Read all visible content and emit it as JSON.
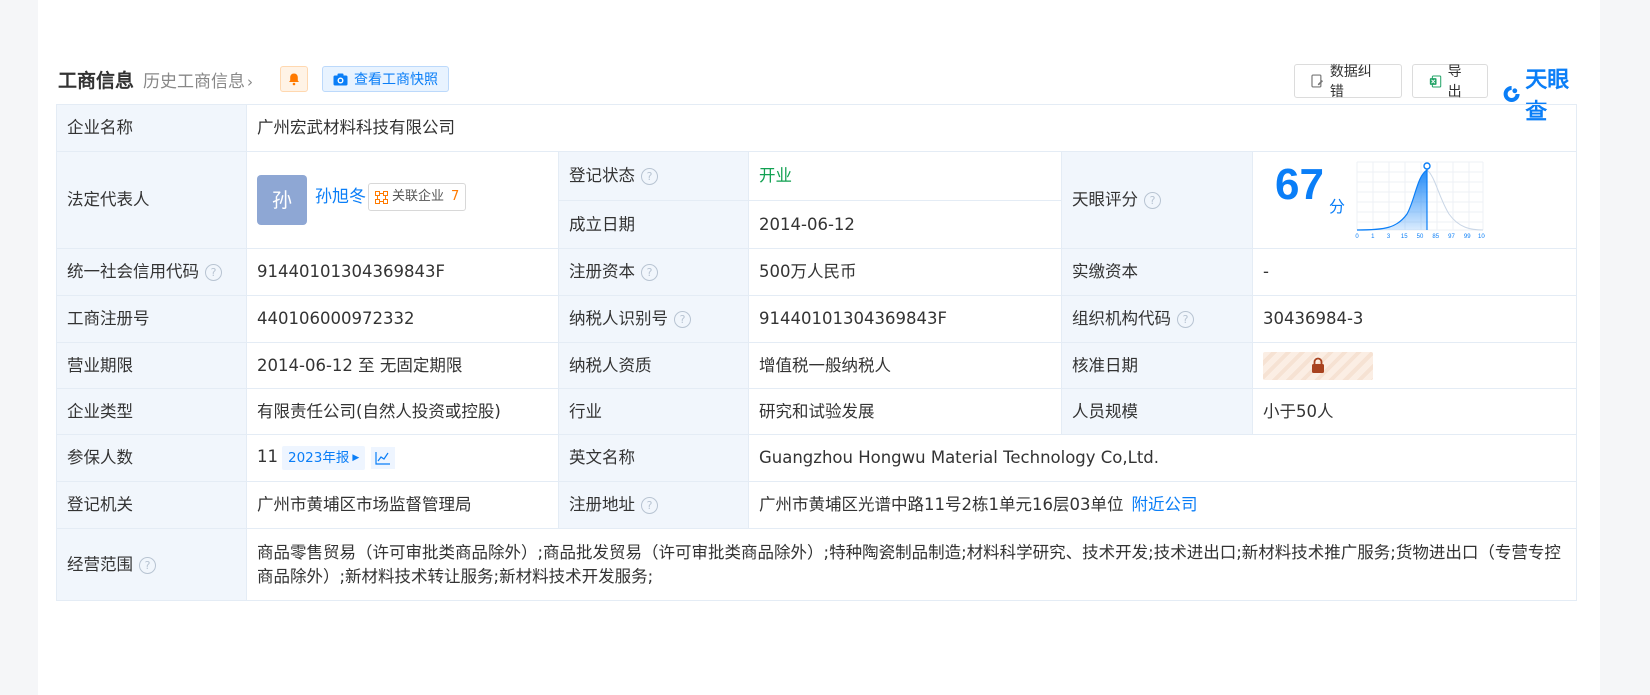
{
  "header": {
    "title": "工商信息",
    "history": "历史工商信息",
    "snapshot": "查看工商快照",
    "correct": "数据纠错",
    "export": "导出",
    "logo": "天眼查"
  },
  "colors": {
    "accent": "#0a7ef7",
    "label_bg": "#f1f6fc",
    "status_green": "#12a152",
    "rel_count": "#ff7a00"
  },
  "company": {
    "name_label": "企业名称",
    "name": "广州宏武材料科技有限公司",
    "legal_label": "法定代表人",
    "legal_avatar": "孙",
    "legal_name": "孙旭冬",
    "related_label": "关联企业",
    "related_count": "7",
    "status_label": "登记状态",
    "status": "开业",
    "founded_label": "成立日期",
    "founded": "2014-06-12",
    "score_label": "天眼评分",
    "score": "67",
    "score_unit": "分",
    "score_axis": [
      "0",
      "1",
      "3",
      "15",
      "50",
      "85",
      "97",
      "99",
      "100"
    ],
    "credit_label": "统一社会信用代码",
    "credit": "91440101304369843F",
    "reg_capital_label": "注册资本",
    "reg_capital": "500万人民币",
    "paid_capital_label": "实缴资本",
    "paid_capital": "-",
    "reg_no_label": "工商注册号",
    "reg_no": "440106000972332",
    "tax_id_label": "纳税人识别号",
    "tax_id": "91440101304369843F",
    "org_code_label": "组织机构代码",
    "org_code": "30436984-3",
    "term_label": "营业期限",
    "term": "2014-06-12 至 无固定期限",
    "taxpayer_label": "纳税人资质",
    "taxpayer": "增值税一般纳税人",
    "approve_label": "核准日期",
    "type_label": "企业类型",
    "type": "有限责任公司(自然人投资或控股)",
    "industry_label": "行业",
    "industry": "研究和试验发展",
    "staff_label": "人员规模",
    "staff": "小于50人",
    "insured_label": "参保人数",
    "insured": "11",
    "insured_year": "2023年报",
    "en_name_label": "英文名称",
    "en_name": "Guangzhou Hongwu Material Technology Co,Ltd.",
    "authority_label": "登记机关",
    "authority": "广州市黄埔区市场监督管理局",
    "address_label": "注册地址",
    "address": "广州市黄埔区光谱中路11号2栋1单元16层03单位",
    "nearby": "附近公司",
    "scope_label": "经营范围",
    "scope": "商品零售贸易（许可审批类商品除外）;商品批发贸易（许可审批类商品除外）;特种陶瓷制品制造;材料科学研究、技术开发;技术进出口;新材料技术推广服务;货物进出口（专营专控商品除外）;新材料技术转让服务;新材料技术开发服务;"
  }
}
